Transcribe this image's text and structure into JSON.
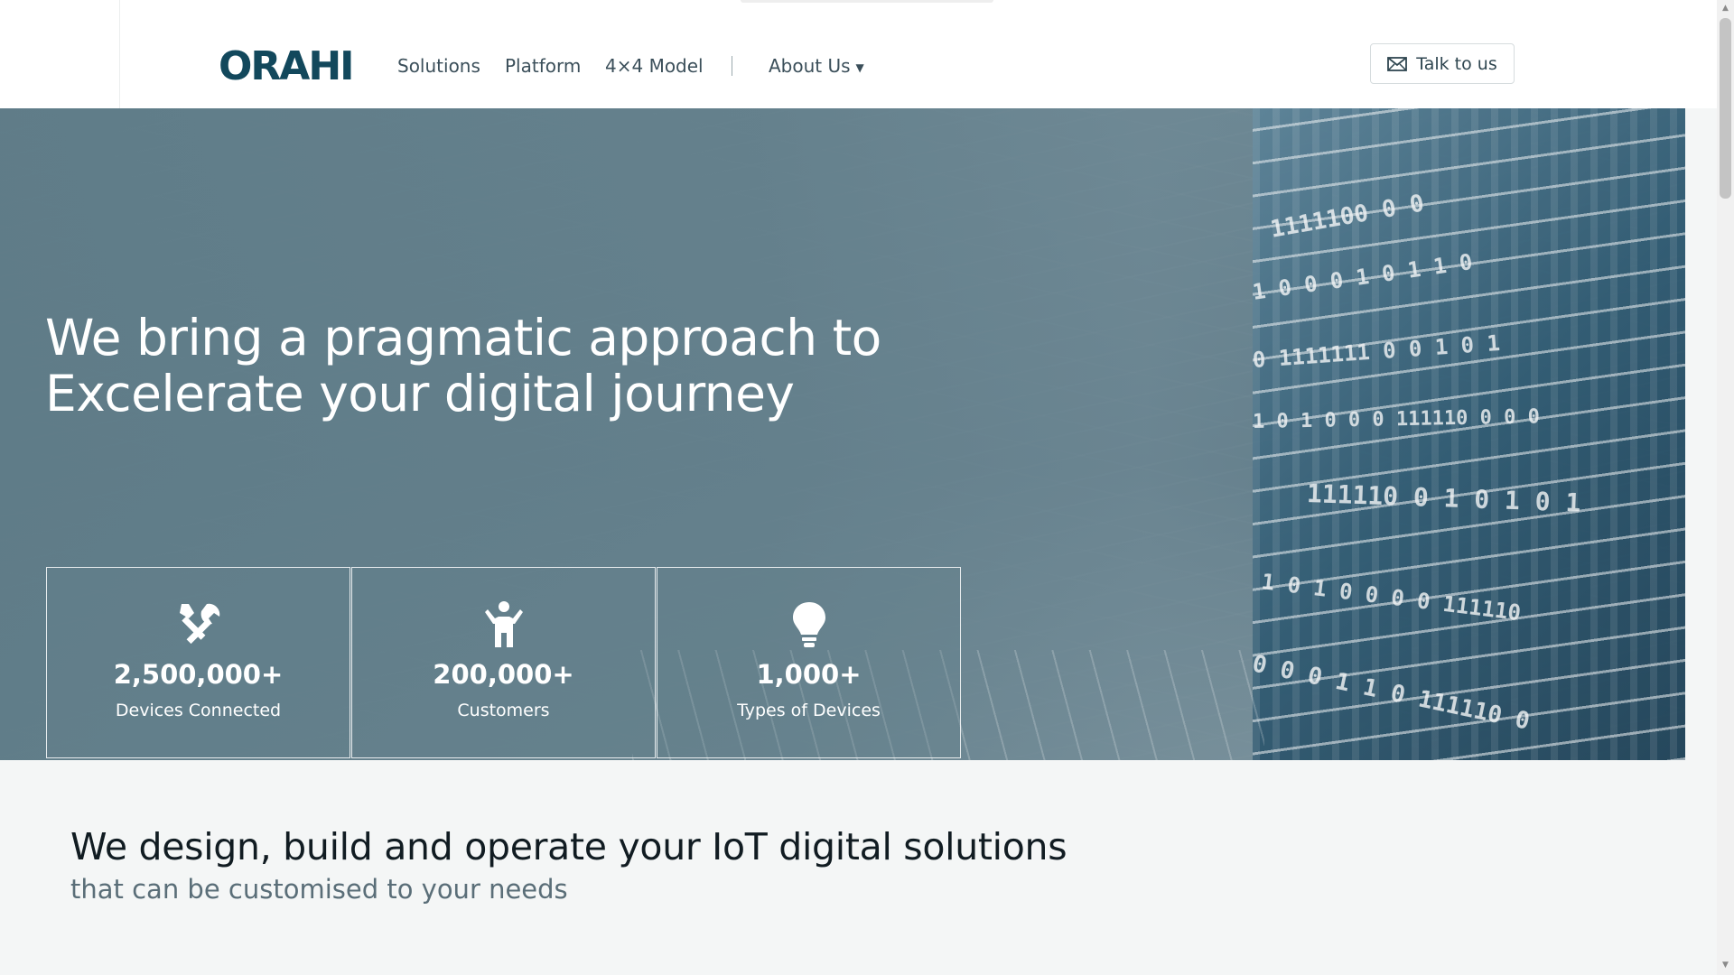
{
  "header": {
    "logo": "ORAHI",
    "nav": [
      {
        "label": "Solutions"
      },
      {
        "label": "Platform"
      },
      {
        "label": "4×4 Model"
      },
      {
        "label": "About Us"
      }
    ],
    "cta_label": "Talk to us",
    "cta_icon": "mail-icon"
  },
  "hero": {
    "title_line1": "We bring a pragmatic approach to",
    "title_line2": "Excelerate your digital journey",
    "stats": [
      {
        "icon": "tools-icon",
        "value": "2,500,000+",
        "label": "Devices Connected"
      },
      {
        "icon": "person-icon",
        "value": "200,000+",
        "label": "Customers"
      },
      {
        "icon": "lightbulb-icon",
        "value": "1,000+",
        "label": "Types of Devices"
      }
    ]
  },
  "section": {
    "title": "We design, build and operate your IoT digital solutions",
    "subtitle": "that can be customised to your needs"
  },
  "colors": {
    "brand": "#12485c",
    "hero_overlay": "#64808c",
    "text_dark": "#111c22",
    "text_muted": "#5a6e78"
  }
}
